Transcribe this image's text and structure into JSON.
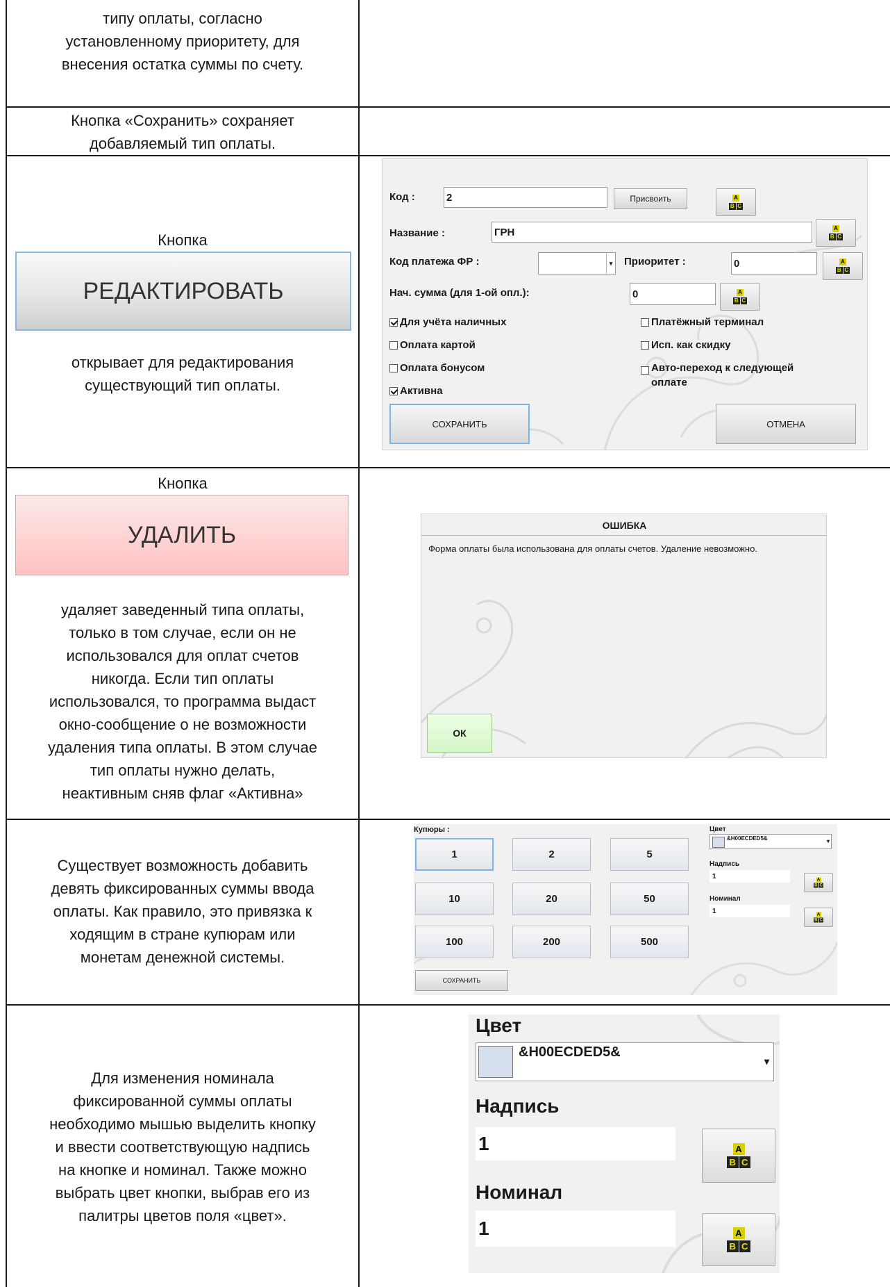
{
  "row1": {
    "lines": [
      "типу оплаты, согласно",
      "установленному приоритету, для",
      "внесения остатка суммы по счету."
    ]
  },
  "row2": {
    "lines": [
      "Кнопка «Сохранить» сохраняет",
      "добавляемый тип оплаты."
    ]
  },
  "row3": {
    "caption_top": "Кнопка",
    "button_label": "РЕДАКТИРОВАТЬ",
    "lines": [
      "открывает для редактирования",
      "существующий тип оплаты."
    ],
    "form": {
      "code_label": "Код :",
      "code_value": "2",
      "assign_label": "Присвоить",
      "name_label": "Название :",
      "name_value": "ГРН",
      "fr_label": "Код платежа ФР :",
      "priority_label": "Приоритет :",
      "priority_value": "0",
      "start_label": "Нач. сумма (для 1-ой опл.):",
      "start_value": "0",
      "chk_cash": "Для учёта наличных",
      "chk_card": "Оплата картой",
      "chk_bonus": "Оплата бонусом",
      "chk_active": "Активна",
      "chk_terminal": "Платёжный терминал",
      "chk_discount": "Исп. как скидку",
      "chk_auto_1": "Авто-переход к следующей",
      "chk_auto_2": "оплате",
      "save_label": "СОХРАНИТЬ",
      "cancel_label": "ОТМЕНА"
    }
  },
  "row4": {
    "caption_top": "Кнопка",
    "button_label": "УДАЛИТЬ",
    "lines": [
      "удаляет заведенный типа оплаты,",
      "только в том случае, если он не",
      "использовался для оплат счетов",
      "никогда. Если тип оплаты",
      "использовался, то программа выдаст",
      "окно-сообщение о не возможности",
      "удаления типа оплаты. В этом случае",
      "тип оплаты нужно делать,",
      "неактивным сняв флаг «Активна»"
    ],
    "dialog": {
      "title": "ОШИБКА",
      "message": "Форма оплаты была использована для оплаты счетов. Удаление невозможно.",
      "ok_label": "ОК"
    }
  },
  "row5": {
    "lines": [
      "Существует возможность добавить",
      "девять фиксированных суммы ввода",
      "оплаты. Как правило, это привязка к",
      "ходящим в стране купюрам или",
      "монетам денежной системы."
    ],
    "panel": {
      "bills_label": "Купюры :",
      "denoms": [
        "1",
        "2",
        "5",
        "10",
        "20",
        "50",
        "100",
        "200",
        "500"
      ],
      "color_label": "Цвет",
      "color_value": "&H00ECDED5&",
      "color_swatch": "#D5DEEC",
      "caption_label": "Надпись",
      "caption_value": "1",
      "nominal_label": "Номинал",
      "nominal_value": "1",
      "save_label": "СОХРАНИТЬ"
    }
  },
  "row6": {
    "lines": [
      "Для изменения номинала",
      "фиксированной суммы оплаты",
      "необходимо мышью выделить кнопку",
      "и ввести соответствующую надпись",
      "на кнопке и номинал. Также можно",
      "выбрать цвет кнопки, выбрав его из",
      "палитры цветов поля «цвет»."
    ],
    "zoom": {
      "color_label": "Цвет",
      "color_value": "&H00ECDED5&",
      "caption_label": "Надпись",
      "caption_value": "1",
      "nominal_label": "Номинал",
      "nominal_value": "1"
    }
  },
  "keyboard_glyphs": {
    "a": "A",
    "b": "B",
    "c": "C"
  }
}
